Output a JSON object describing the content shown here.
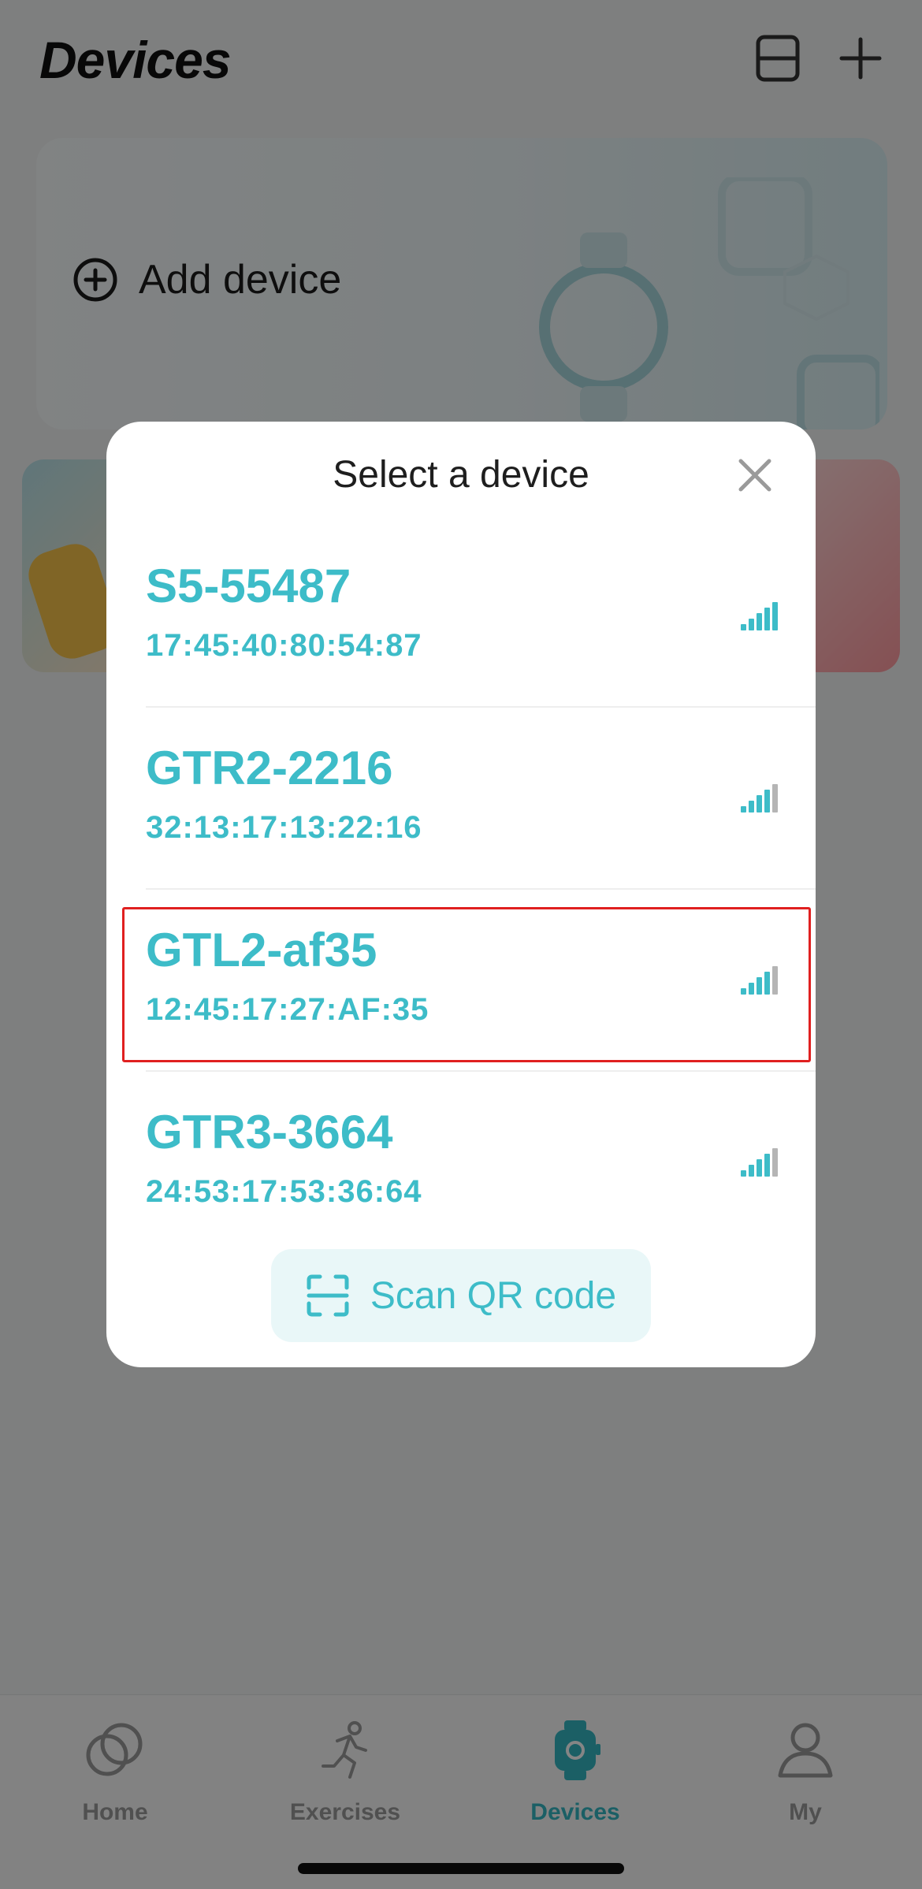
{
  "header": {
    "title": "Devices"
  },
  "add_card": {
    "label": "Add device"
  },
  "tabs": [
    {
      "label": "Home",
      "icon": "circles-icon",
      "active": false
    },
    {
      "label": "Exercises",
      "icon": "runner-icon",
      "active": false
    },
    {
      "label": "Devices",
      "icon": "watch-icon",
      "active": true
    },
    {
      "label": "My",
      "icon": "person-icon",
      "active": false
    }
  ],
  "modal": {
    "title": "Select a device",
    "devices": [
      {
        "name": "S5-55487",
        "mac": "17:45:40:80:54:87",
        "signal_bars": 5
      },
      {
        "name": "GTR2-2216",
        "mac": "32:13:17:13:22:16",
        "signal_bars": 4
      },
      {
        "name": "GTL2-af35",
        "mac": "12:45:17:27:AF:35",
        "signal_bars": 4
      },
      {
        "name": "GTR3-3664",
        "mac": "24:53:17:53:36:64",
        "signal_bars": 4
      }
    ],
    "selected_index": 2,
    "scan_button": "Scan QR code"
  },
  "colors": {
    "accent": "#3dbcc8",
    "highlight": "#e02020",
    "overlay": "rgba(0,0,0,0.48)"
  }
}
